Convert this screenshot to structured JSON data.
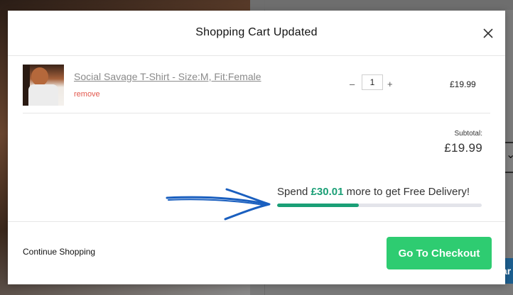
{
  "modal": {
    "title": "Shopping Cart Updated",
    "close_icon": "close-icon"
  },
  "cart": {
    "items": [
      {
        "name": "Social Savage T-Shirt - Size:M, Fit:Female",
        "remove_label": "remove",
        "quantity": "1",
        "minus_symbol": "–",
        "plus_symbol": "+",
        "price": "£19.99",
        "thumbnail_icon": "product-thumbnail"
      }
    ],
    "subtotal_label": "Subtotal:",
    "subtotal_value": "£19.99"
  },
  "delivery": {
    "prefix": "Spend ",
    "amount": "£30.01",
    "suffix": " more to get Free Delivery!",
    "progress_fraction": 0.4,
    "accent_color": "#1a9f76"
  },
  "footer": {
    "continue_label": "Continue Shopping",
    "checkout_label": "Go To Checkout",
    "checkout_color": "#2ecc71"
  },
  "annotation": {
    "arrow_icon": "hand-drawn-arrow-icon",
    "arrow_color": "#1a5fbf"
  }
}
